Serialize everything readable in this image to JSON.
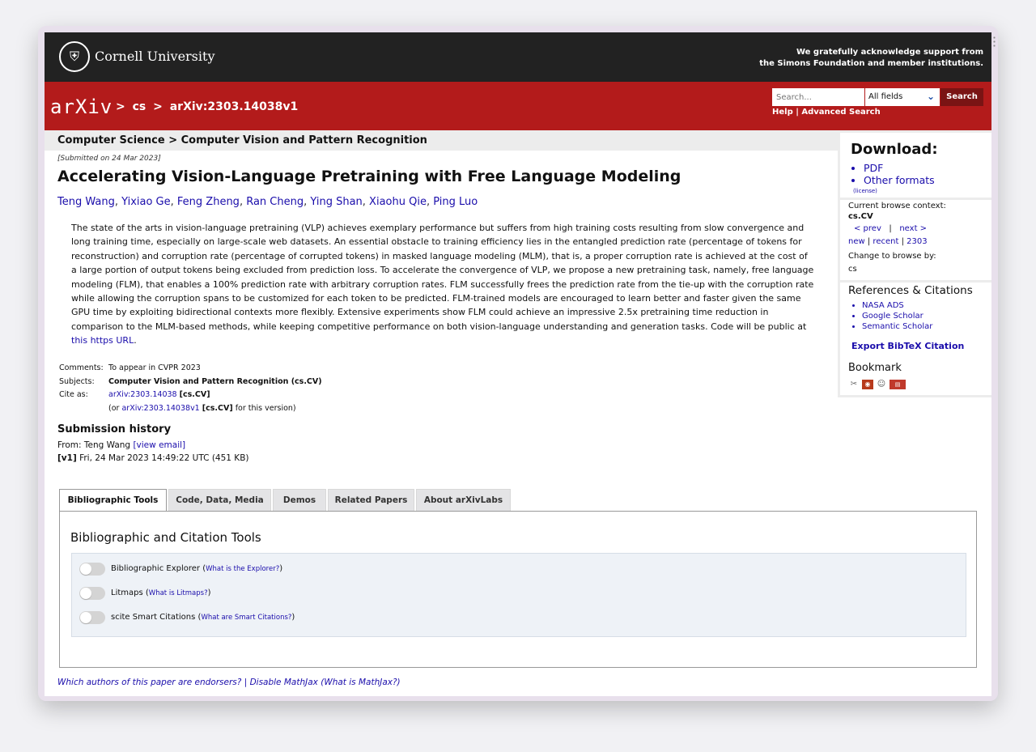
{
  "topbar": {
    "university": "Cornell University",
    "support_line1": "We gratefully acknowledge support from",
    "support_line2": "the Simons Foundation and member institutions."
  },
  "header": {
    "logo_text": "arXiv",
    "crumb_cs": "cs",
    "crumb_sep": ">",
    "crumb_id": "arXiv:2303.14038v1",
    "search_placeholder": "Search...",
    "search_field_option": "All fields",
    "search_button": "Search",
    "help_link": "Help",
    "help_sep": "|",
    "advanced_link": "Advanced Search"
  },
  "subject_header": "Computer Science > Computer Vision and Pattern Recognition",
  "paper": {
    "submitted": "[Submitted on 24 Mar 2023]",
    "title": "Accelerating Vision-Language Pretraining with Free Language Modeling",
    "authors": [
      "Teng Wang",
      "Yixiao Ge",
      "Feng Zheng",
      "Ran Cheng",
      "Ying Shan",
      "Xiaohu Qie",
      "Ping Luo"
    ],
    "abstract": "The state of the arts in vision-language pretraining (VLP) achieves exemplary performance but suffers from high training costs resulting from slow convergence and long training time, especially on large-scale web datasets. An essential obstacle to training efficiency lies in the entangled prediction rate (percentage of tokens for reconstruction) and corruption rate (percentage of corrupted tokens) in masked language modeling (MLM), that is, a proper corruption rate is achieved at the cost of a large portion of output tokens being excluded from prediction loss. To accelerate the convergence of VLP, we propose a new pretraining task, namely, free language modeling (FLM), that enables a 100% prediction rate with arbitrary corruption rates. FLM successfully frees the prediction rate from the tie-up with the corruption rate while allowing the corruption spans to be customized for each token to be predicted. FLM-trained models are encouraged to learn better and faster given the same GPU time by exploiting bidirectional contexts more flexibly. Extensive experiments show FLM could achieve an impressive 2.5x pretraining time reduction in comparison to the MLM-based methods, while keeping competitive performance on both vision-language understanding and generation tasks. Code will be public at",
    "abstract_link": "this https URL",
    "abstract_end": ".",
    "comments_label": "Comments:",
    "comments": "To appear in CVPR 2023",
    "subjects_label": "Subjects:",
    "subjects": "Computer Vision and Pattern Recognition (cs.CV)",
    "cite_label": "Cite as:",
    "cite_link": "arXiv:2303.14038",
    "cite_cat": "[cs.CV]",
    "cite_or": "(or",
    "cite_v_link": "arXiv:2303.14038v1",
    "cite_v_cat": "[cs.CV]",
    "cite_v_suffix": "for this version)"
  },
  "history": {
    "title": "Submission history",
    "from_prefix": "From: Teng Wang",
    "view_email": "[view email]",
    "v1_label": "[v1]",
    "v1_text": "Fri, 24 Mar 2023 14:49:22 UTC (451 KB)"
  },
  "tabs": [
    {
      "label": "Bibliographic Tools",
      "active": true
    },
    {
      "label": "Code, Data, Media",
      "active": false
    },
    {
      "label": "Demos",
      "active": false
    },
    {
      "label": "Related Papers",
      "active": false
    },
    {
      "label": "About arXivLabs",
      "active": false
    }
  ],
  "panel": {
    "title": "Bibliographic and Citation Tools",
    "tools": [
      {
        "label": "Bibliographic Explorer",
        "help": "What is the Explorer?",
        "on": false
      },
      {
        "label": "Litmaps",
        "help": "What is Litmaps?",
        "on": false
      },
      {
        "label": "scite Smart Citations",
        "help": "What are Smart Citations?",
        "on": false
      }
    ]
  },
  "footer": {
    "endorsers": "Which authors of this paper are endorsers?",
    "sep": "|",
    "mathjax": "Disable MathJax",
    "what_mathjax": "(What is MathJax?)"
  },
  "sidebar": {
    "download_title": "Download:",
    "download_items": [
      "PDF",
      "Other formats"
    ],
    "license": "(license)",
    "browse_context_label": "Current browse context:",
    "browse_context": "cs.CV",
    "prev": "< prev",
    "nav_sep": "|",
    "next": "next >",
    "new": "new",
    "recent": "recent",
    "yymm": "2303",
    "change_browse": "Change to browse by:",
    "browse_cs": "cs",
    "refs_title": "References & Citations",
    "refs": [
      "NASA ADS",
      "Google Scholar",
      "Semantic Scholar"
    ],
    "export": "Export BibTeX Citation",
    "bookmark_title": "Bookmark"
  },
  "colors": {
    "arxiv_red": "#b31b1b",
    "topbar": "#222222",
    "link": "#1a0dab",
    "search_button": "#7a1414"
  }
}
